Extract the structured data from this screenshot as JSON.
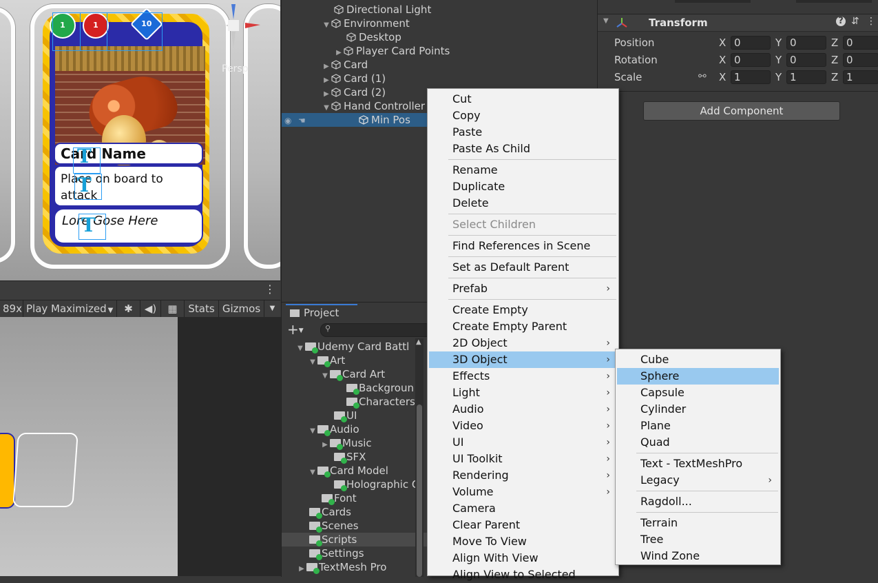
{
  "scene": {
    "persp_label": "Persp",
    "card": {
      "name": "Card Name",
      "description": "Place on board to attack",
      "lore": "Lore Gose Here",
      "stat_left": "1",
      "stat_mid": "1",
      "stat_right": "10",
      "text_glyph": "T"
    }
  },
  "game_toolbar": {
    "zoom_value": "89x",
    "play_mode": "Play Maximized",
    "stats_label": "Stats",
    "gizmos_label": "Gizmos"
  },
  "hierarchy": {
    "items": [
      {
        "label": "Directional Light"
      },
      {
        "label": "Environment"
      },
      {
        "label": "Desktop"
      },
      {
        "label": "Player Card Points"
      },
      {
        "label": "Card"
      },
      {
        "label": "Card (1)"
      },
      {
        "label": "Card (2)"
      },
      {
        "label": "Hand Controller"
      },
      {
        "label": "Min Pos"
      }
    ]
  },
  "project": {
    "tab_label": "Project",
    "tree": [
      {
        "label": "Udemy Card Battl"
      },
      {
        "label": "Art"
      },
      {
        "label": "Card Art"
      },
      {
        "label": "Backgroun"
      },
      {
        "label": "Characters"
      },
      {
        "label": "UI"
      },
      {
        "label": "Audio"
      },
      {
        "label": "Music"
      },
      {
        "label": "SFX"
      },
      {
        "label": "Card Model"
      },
      {
        "label": "Holographic C"
      },
      {
        "label": "Font"
      },
      {
        "label": "Cards"
      },
      {
        "label": "Scenes"
      },
      {
        "label": "Scripts"
      },
      {
        "label": "Settings"
      },
      {
        "label": "TextMesh Pro"
      }
    ]
  },
  "inspector": {
    "component_title": "Transform",
    "position_label": "Position",
    "rotation_label": "Rotation",
    "scale_label": "Scale",
    "axis_x": "X",
    "axis_y": "Y",
    "axis_z": "Z",
    "position": {
      "x": "0",
      "y": "0",
      "z": "0"
    },
    "rotation": {
      "x": "0",
      "y": "0",
      "z": "0"
    },
    "scale": {
      "x": "1",
      "y": "1",
      "z": "1"
    },
    "add_component": "Add Component"
  },
  "context_menu": {
    "items": [
      {
        "label": "Cut"
      },
      {
        "label": "Copy"
      },
      {
        "label": "Paste"
      },
      {
        "label": "Paste As Child"
      },
      {
        "label": "Rename"
      },
      {
        "label": "Duplicate"
      },
      {
        "label": "Delete"
      },
      {
        "label": "Select Children"
      },
      {
        "label": "Find References in Scene"
      },
      {
        "label": "Set as Default Parent"
      },
      {
        "label": "Prefab"
      },
      {
        "label": "Create Empty"
      },
      {
        "label": "Create Empty Parent"
      },
      {
        "label": "2D Object"
      },
      {
        "label": "3D Object"
      },
      {
        "label": "Effects"
      },
      {
        "label": "Light"
      },
      {
        "label": "Audio"
      },
      {
        "label": "Video"
      },
      {
        "label": "UI"
      },
      {
        "label": "UI Toolkit"
      },
      {
        "label": "Rendering"
      },
      {
        "label": "Volume"
      },
      {
        "label": "Camera"
      },
      {
        "label": "Clear Parent"
      },
      {
        "label": "Move To View"
      },
      {
        "label": "Align With View"
      },
      {
        "label": "Align View to Selected"
      }
    ]
  },
  "submenu_3d": {
    "items": [
      {
        "label": "Cube"
      },
      {
        "label": "Sphere"
      },
      {
        "label": "Capsule"
      },
      {
        "label": "Cylinder"
      },
      {
        "label": "Plane"
      },
      {
        "label": "Quad"
      },
      {
        "label": "Text - TextMeshPro"
      },
      {
        "label": "Legacy"
      },
      {
        "label": "Ragdoll..."
      },
      {
        "label": "Terrain"
      },
      {
        "label": "Tree"
      },
      {
        "label": "Wind Zone"
      }
    ]
  },
  "colors": {
    "selection_blue": "#2c5d87",
    "menu_highlight": "#99c9ef",
    "menu_bg": "#f2f2f2",
    "editor_bg": "#383838"
  }
}
